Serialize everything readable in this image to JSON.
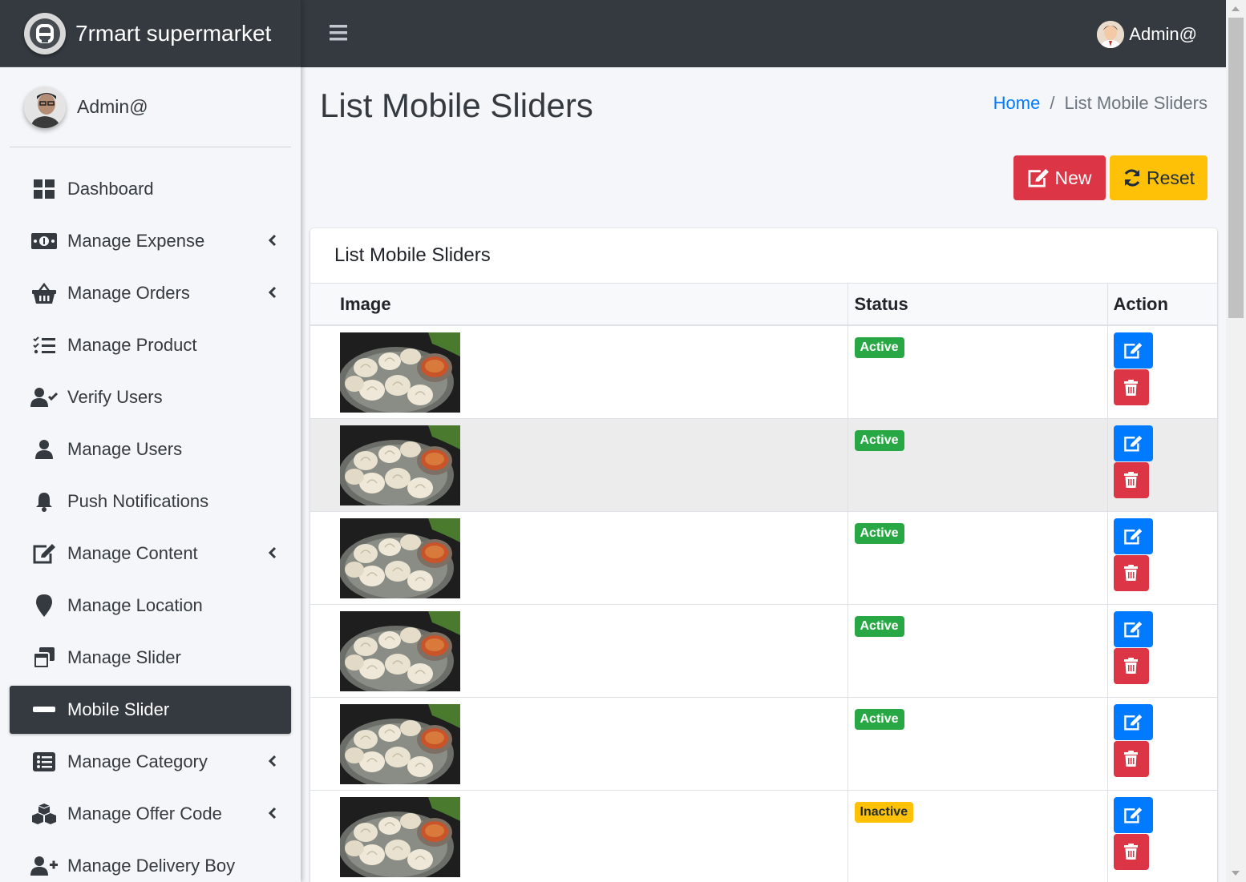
{
  "brand": {
    "name": "7rmart supermarket"
  },
  "sidebar_user": {
    "name": "Admin@"
  },
  "top_user": {
    "name": "Admin@"
  },
  "nav": [
    {
      "label": "Dashboard",
      "icon": "dashboard-icon",
      "has_submenu": false
    },
    {
      "label": "Manage Expense",
      "icon": "money-bill-icon",
      "has_submenu": true
    },
    {
      "label": "Manage Orders",
      "icon": "basket-icon",
      "has_submenu": true
    },
    {
      "label": "Manage Product",
      "icon": "tasks-list-icon",
      "has_submenu": false
    },
    {
      "label": "Verify Users",
      "icon": "user-check-icon",
      "has_submenu": false
    },
    {
      "label": "Manage Users",
      "icon": "user-icon",
      "has_submenu": false
    },
    {
      "label": "Push Notifications",
      "icon": "bell-icon",
      "has_submenu": false
    },
    {
      "label": "Manage Content",
      "icon": "edit-icon",
      "has_submenu": true
    },
    {
      "label": "Manage Location",
      "icon": "map-marker-icon",
      "has_submenu": false
    },
    {
      "label": "Manage Slider",
      "icon": "window-restore-icon",
      "has_submenu": false
    },
    {
      "label": "Mobile Slider",
      "icon": "minus-icon",
      "has_submenu": false,
      "active": true
    },
    {
      "label": "Manage Category",
      "icon": "list-alt-icon",
      "has_submenu": true
    },
    {
      "label": "Manage Offer Code",
      "icon": "cubes-icon",
      "has_submenu": true
    },
    {
      "label": "Manage Delivery Boy",
      "icon": "user-plus-icon",
      "has_submenu": false
    }
  ],
  "page": {
    "title": "List Mobile Sliders",
    "breadcrumb": {
      "home": "Home",
      "separator": "/",
      "current": "List Mobile Sliders"
    }
  },
  "buttons": {
    "new_label": "New",
    "reset_label": "Reset"
  },
  "card": {
    "title": "List Mobile Sliders",
    "columns": [
      "Image",
      "Status",
      "Action"
    ],
    "rows": [
      {
        "image": "momo-dumplings-thumbnail",
        "status": "Active"
      },
      {
        "image": "momo-dumplings-thumbnail",
        "status": "Active"
      },
      {
        "image": "momo-dumplings-thumbnail",
        "status": "Active"
      },
      {
        "image": "momo-dumplings-thumbnail",
        "status": "Active"
      },
      {
        "image": "momo-dumplings-thumbnail",
        "status": "Active"
      },
      {
        "image": "momo-dumplings-thumbnail",
        "status": "Inactive"
      }
    ]
  },
  "colors": {
    "dark": "#343a40",
    "primary": "#007bff",
    "danger": "#dc3545",
    "warning": "#ffc107",
    "success": "#28a745"
  }
}
